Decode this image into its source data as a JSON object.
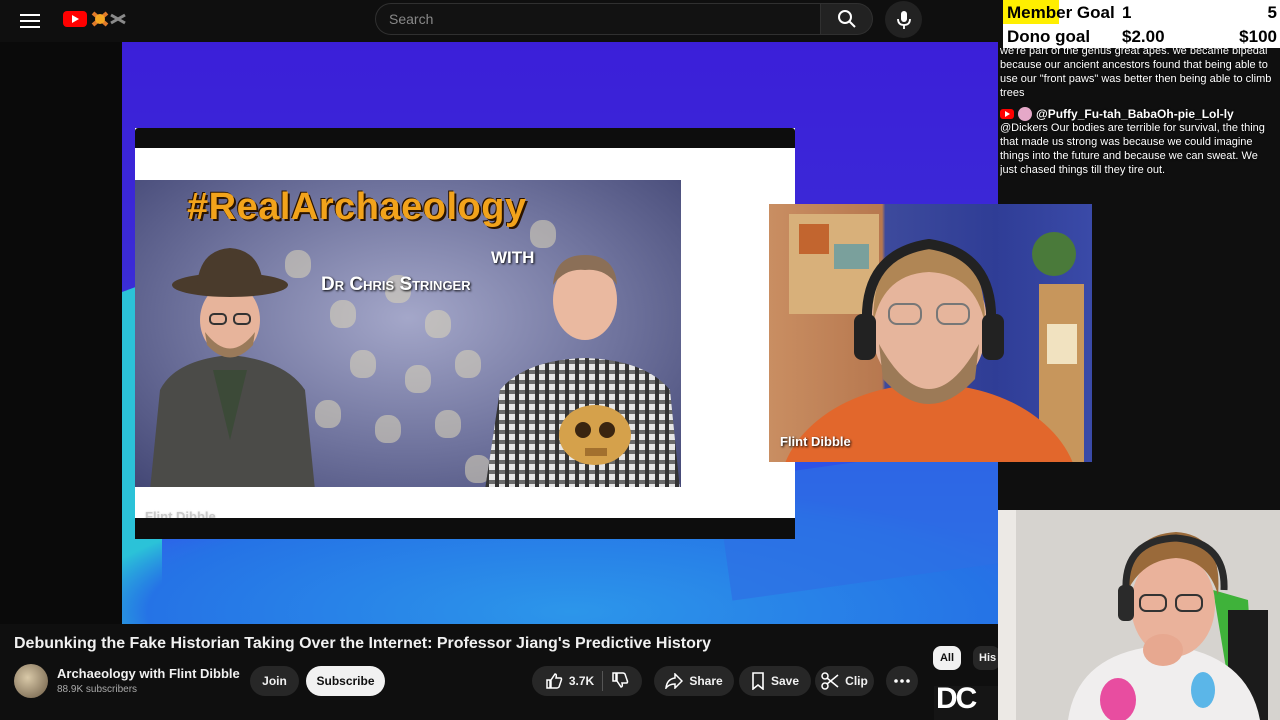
{
  "topbar": {
    "search_placeholder": "Search",
    "logo_icon": "youtube-logo-icon"
  },
  "player": {
    "slide": {
      "thumbnail_title": "#RealArchaeology",
      "thumbnail_with": "WITH",
      "thumbnail_guest": "Dr Chris Stringer",
      "watermark": "Flint Dibble"
    },
    "camera_name": "Flint Dibble"
  },
  "video": {
    "title": "Debunking the Fake Historian Taking Over the Internet: Professor Jiang's Predictive History",
    "channel_name": "Archaeology with Flint Dibble",
    "subscribers": "88.9K subscribers",
    "join_label": "Join",
    "subscribe_label": "Subscribe",
    "like_count": "3.7K",
    "share_label": "Share",
    "save_label": "Save",
    "clip_label": "Clip"
  },
  "chips": {
    "all": "All",
    "history": "His"
  },
  "recommendation": {
    "thumb_text": "DC"
  },
  "goals": {
    "member": {
      "label": "Member Goal",
      "current": "1",
      "target": "5",
      "progress": 0.2
    },
    "dono": {
      "label": "Dono goal",
      "current": "$2.00",
      "target": "$100",
      "progress": 0.02
    },
    "highlight_color": "#ffef00"
  },
  "chat": {
    "messages": [
      {
        "author": "",
        "text": "we're part of the genus great apes. we became bipedal because our ancient ancestors found that being able to use our \"front paws\" was better then being able to climb trees"
      },
      {
        "author": "@Puffy_Fu-tah_BabaOh-pie_Lol-ly",
        "text": "@Dickers Our bodies are terrible for survival, the thing that made us strong was because we could imagine things into the future and because we can sweat. We just chased things till they tire out."
      }
    ]
  },
  "colors": {
    "accent_red": "#ff0000",
    "stage_blue": "#3b1fd9",
    "thumb_orange": "#f2a31b"
  }
}
